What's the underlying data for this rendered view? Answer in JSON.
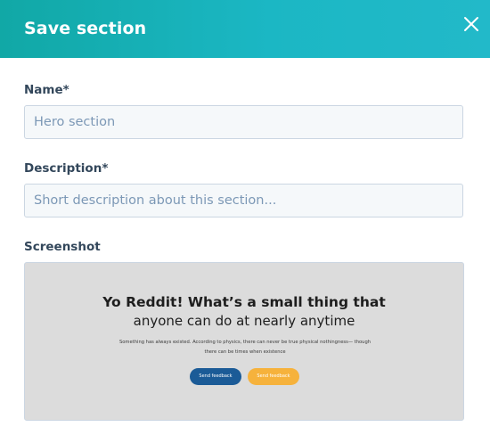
{
  "dialog": {
    "title": "Save section",
    "accent_color": "#17b2bb"
  },
  "form": {
    "name": {
      "label": "Name*",
      "value": "",
      "placeholder": "Hero section"
    },
    "description": {
      "label": "Description*",
      "value": "",
      "placeholder": "Short description about this section..."
    },
    "screenshot": {
      "label": "Screenshot",
      "preview": {
        "title": "Yo Reddit! What’s a small thing that",
        "subtitle": "anyone can do at nearly anytime",
        "body": "Something has always existed. According to physics, there can never be true physical nothingness— though there can be times when existence",
        "primary_button": "Send feedback",
        "secondary_button": "Send feedback",
        "primary_color": "#1b5b97",
        "secondary_color": "#f6b23c"
      }
    }
  },
  "icons": {
    "close": "close-icon"
  }
}
